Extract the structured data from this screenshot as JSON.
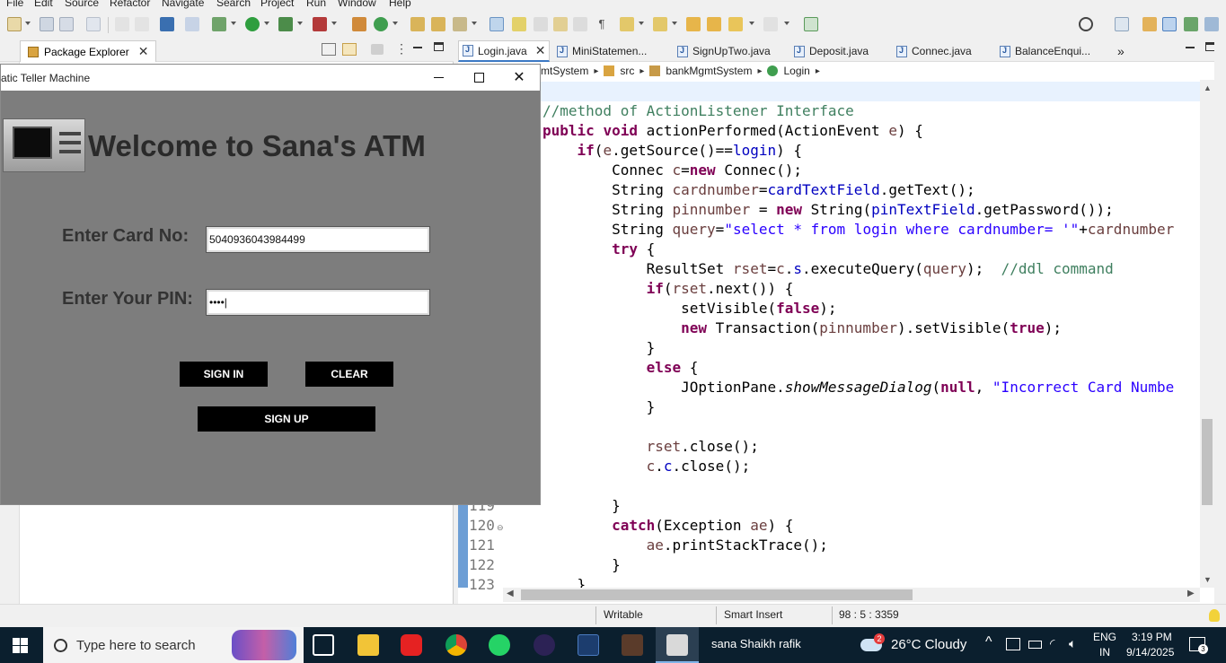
{
  "menu": [
    "File",
    "Edit",
    "Source",
    "Refactor",
    "Navigate",
    "Search",
    "Project",
    "Run",
    "Window",
    "Help"
  ],
  "left_panel": {
    "tab_label": "Package Explorer"
  },
  "editor": {
    "tabs": [
      "Login.java",
      "MiniStatemen...",
      "SignUpTwo.java",
      "Deposit.java",
      "Connec.java",
      "BalanceEnqui..."
    ],
    "overflow_label": "»",
    "breadcrumb": [
      "mtSystem",
      "src",
      "bankMgmtSystem",
      "Login"
    ],
    "code": [
      "//method of ActionListener Interface",
      "public void actionPerformed(ActionEvent e) {",
      "    if(e.getSource()==login) {",
      "        Connec c=new Connec();",
      "        String cardnumber=cardTextField.getText();",
      "        String pinnumber = new String(pinTextField.getPassword());",
      "        String query=\"select * from login where cardnumber= '\"+cardnumber",
      "        try {",
      "            ResultSet rset=c.s.executeQuery(query);  //ddl command",
      "            if(rset.next()) {",
      "                setVisible(false);",
      "                new Transaction(pinnumber).setVisible(true);",
      "            }",
      "            else {",
      "                JOptionPane.showMessageDialog(null, \"Incorrect Card Numbe",
      "            }",
      "",
      "            rset.close();",
      "            c.c.close();",
      "",
      "        }",
      "        catch(Exception ae) {",
      "            ae.printStackTrace();",
      "        }",
      "    }"
    ],
    "line_numbers": [
      "119",
      "120",
      "121",
      "122",
      "123"
    ]
  },
  "status": {
    "writable": "Writable",
    "insert_mode": "Smart Insert",
    "position": "98 : 5 : 3359"
  },
  "taskbar": {
    "search_placeholder": "Type here to search",
    "user_label": "sana Shaikh rafik",
    "weather_badge": "2",
    "weather": "26°C  Cloudy",
    "lang_top": "ENG",
    "lang_bottom": "IN",
    "time": "3:19 PM",
    "date": "9/14/2025",
    "notification_count": "3"
  },
  "atm": {
    "window_title": "atic Teller Machine",
    "heading": "Welcome to Sana's ATM",
    "card_label": "Enter Card No:",
    "card_value": "5040936043984499",
    "pin_label": "Enter Your PIN:",
    "pin_value": "••••|",
    "signin_label": "SIGN IN",
    "clear_label": "CLEAR",
    "signup_label": "SIGN UP"
  },
  "colors": {
    "keyword": "#7f0055",
    "comment": "#3f7f5f",
    "string": "#2a00ff",
    "field": "#0000c0",
    "atm_background": "#7d7d7d",
    "taskbar": "#0b1f2e"
  }
}
